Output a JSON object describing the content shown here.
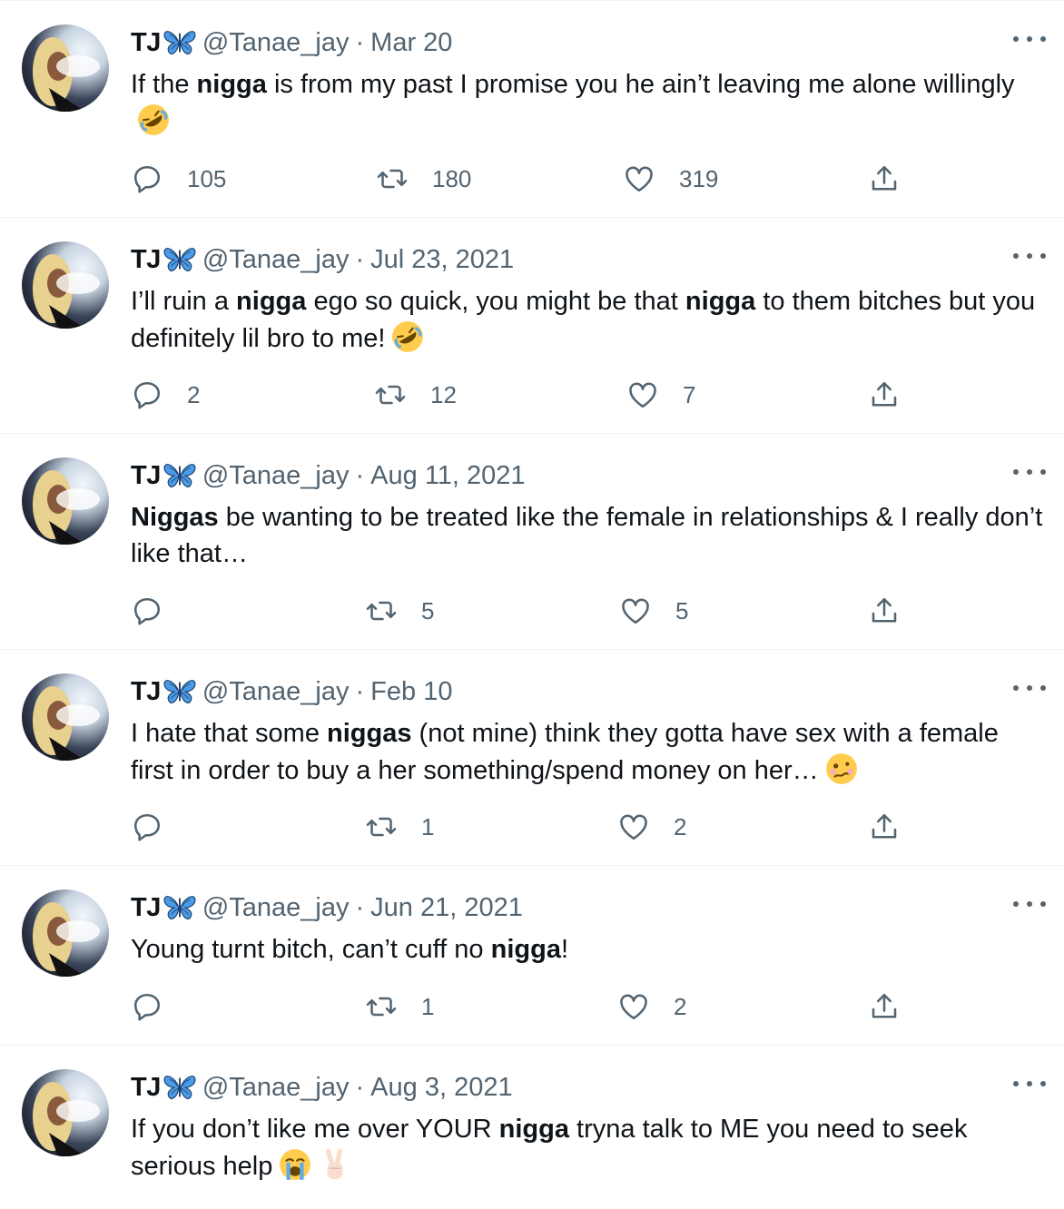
{
  "user": {
    "name": "TJ",
    "handle": "@Tanae_jay",
    "separator": "·"
  },
  "tweets": [
    {
      "date": "Mar 20",
      "segments": [
        {
          "t": "If the ",
          "b": false
        },
        {
          "t": "nigga",
          "b": true
        },
        {
          "t": " is from my past I promise you he ain’t leaving me alone willingly",
          "b": false
        }
      ],
      "emojis": [
        "rofl"
      ],
      "replies": "105",
      "retweets": "180",
      "likes": "319"
    },
    {
      "date": "Jul 23, 2021",
      "segments": [
        {
          "t": "I’ll ruin a ",
          "b": false
        },
        {
          "t": "nigga",
          "b": true
        },
        {
          "t": " ego so quick, you might be that ",
          "b": false
        },
        {
          "t": "nigga",
          "b": true
        },
        {
          "t": " to them bitches but you definitely lil bro to me!",
          "b": false
        }
      ],
      "emojis": [
        "rofl"
      ],
      "replies": "2",
      "retweets": "12",
      "likes": "7"
    },
    {
      "date": "Aug 11, 2021",
      "segments": [
        {
          "t": "Niggas",
          "b": true
        },
        {
          "t": " be wanting to be treated like the female in relationships & I really don’t like that…",
          "b": false
        }
      ],
      "emojis": [],
      "replies": "",
      "retweets": "5",
      "likes": "5"
    },
    {
      "date": "Feb 10",
      "segments": [
        {
          "t": "I hate that some ",
          "b": false
        },
        {
          "t": "niggas",
          "b": true
        },
        {
          "t": " (not mine) think they gotta have sex with a female first in order to buy a her something/spend money on her…",
          "b": false
        }
      ],
      "emojis": [
        "woozy"
      ],
      "replies": "",
      "retweets": "1",
      "likes": "2"
    },
    {
      "date": "Jun 21, 2021",
      "segments": [
        {
          "t": "Young turnt bitch, can’t cuff no ",
          "b": false
        },
        {
          "t": "nigga",
          "b": true
        },
        {
          "t": "!",
          "b": false
        }
      ],
      "emojis": [],
      "replies": "",
      "retweets": "1",
      "likes": "2"
    },
    {
      "date": "Aug 3, 2021",
      "segments": [
        {
          "t": "If you don’t like me over YOUR ",
          "b": false
        },
        {
          "t": "nigga",
          "b": true
        },
        {
          "t": " tryna talk to ME you need to seek serious help",
          "b": false
        }
      ],
      "emojis": [
        "loudly-crying",
        "victory-hand"
      ],
      "replies": "",
      "retweets": "",
      "likes": ""
    }
  ],
  "colors": {
    "text": "#0f1419",
    "secondary": "#536471",
    "divider": "#eff3f4",
    "butterfly": "#4a9be8"
  },
  "icons": [
    "reply-icon",
    "retweet-icon",
    "like-icon",
    "share-icon",
    "more-icon",
    "butterfly-icon"
  ]
}
